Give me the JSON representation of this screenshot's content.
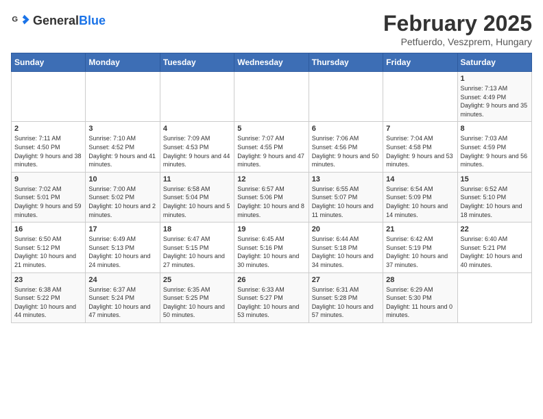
{
  "logo": {
    "text_general": "General",
    "text_blue": "Blue"
  },
  "header": {
    "title": "February 2025",
    "subtitle": "Petfuerdo, Veszprem, Hungary"
  },
  "calendar": {
    "weekdays": [
      "Sunday",
      "Monday",
      "Tuesday",
      "Wednesday",
      "Thursday",
      "Friday",
      "Saturday"
    ],
    "weeks": [
      {
        "days": [
          {
            "num": "",
            "info": ""
          },
          {
            "num": "",
            "info": ""
          },
          {
            "num": "",
            "info": ""
          },
          {
            "num": "",
            "info": ""
          },
          {
            "num": "",
            "info": ""
          },
          {
            "num": "",
            "info": ""
          },
          {
            "num": "1",
            "info": "Sunrise: 7:13 AM\nSunset: 4:49 PM\nDaylight: 9 hours and 35 minutes."
          }
        ]
      },
      {
        "days": [
          {
            "num": "2",
            "info": "Sunrise: 7:11 AM\nSunset: 4:50 PM\nDaylight: 9 hours and 38 minutes."
          },
          {
            "num": "3",
            "info": "Sunrise: 7:10 AM\nSunset: 4:52 PM\nDaylight: 9 hours and 41 minutes."
          },
          {
            "num": "4",
            "info": "Sunrise: 7:09 AM\nSunset: 4:53 PM\nDaylight: 9 hours and 44 minutes."
          },
          {
            "num": "5",
            "info": "Sunrise: 7:07 AM\nSunset: 4:55 PM\nDaylight: 9 hours and 47 minutes."
          },
          {
            "num": "6",
            "info": "Sunrise: 7:06 AM\nSunset: 4:56 PM\nDaylight: 9 hours and 50 minutes."
          },
          {
            "num": "7",
            "info": "Sunrise: 7:04 AM\nSunset: 4:58 PM\nDaylight: 9 hours and 53 minutes."
          },
          {
            "num": "8",
            "info": "Sunrise: 7:03 AM\nSunset: 4:59 PM\nDaylight: 9 hours and 56 minutes."
          }
        ]
      },
      {
        "days": [
          {
            "num": "9",
            "info": "Sunrise: 7:02 AM\nSunset: 5:01 PM\nDaylight: 9 hours and 59 minutes."
          },
          {
            "num": "10",
            "info": "Sunrise: 7:00 AM\nSunset: 5:02 PM\nDaylight: 10 hours and 2 minutes."
          },
          {
            "num": "11",
            "info": "Sunrise: 6:58 AM\nSunset: 5:04 PM\nDaylight: 10 hours and 5 minutes."
          },
          {
            "num": "12",
            "info": "Sunrise: 6:57 AM\nSunset: 5:06 PM\nDaylight: 10 hours and 8 minutes."
          },
          {
            "num": "13",
            "info": "Sunrise: 6:55 AM\nSunset: 5:07 PM\nDaylight: 10 hours and 11 minutes."
          },
          {
            "num": "14",
            "info": "Sunrise: 6:54 AM\nSunset: 5:09 PM\nDaylight: 10 hours and 14 minutes."
          },
          {
            "num": "15",
            "info": "Sunrise: 6:52 AM\nSunset: 5:10 PM\nDaylight: 10 hours and 18 minutes."
          }
        ]
      },
      {
        "days": [
          {
            "num": "16",
            "info": "Sunrise: 6:50 AM\nSunset: 5:12 PM\nDaylight: 10 hours and 21 minutes."
          },
          {
            "num": "17",
            "info": "Sunrise: 6:49 AM\nSunset: 5:13 PM\nDaylight: 10 hours and 24 minutes."
          },
          {
            "num": "18",
            "info": "Sunrise: 6:47 AM\nSunset: 5:15 PM\nDaylight: 10 hours and 27 minutes."
          },
          {
            "num": "19",
            "info": "Sunrise: 6:45 AM\nSunset: 5:16 PM\nDaylight: 10 hours and 30 minutes."
          },
          {
            "num": "20",
            "info": "Sunrise: 6:44 AM\nSunset: 5:18 PM\nDaylight: 10 hours and 34 minutes."
          },
          {
            "num": "21",
            "info": "Sunrise: 6:42 AM\nSunset: 5:19 PM\nDaylight: 10 hours and 37 minutes."
          },
          {
            "num": "22",
            "info": "Sunrise: 6:40 AM\nSunset: 5:21 PM\nDaylight: 10 hours and 40 minutes."
          }
        ]
      },
      {
        "days": [
          {
            "num": "23",
            "info": "Sunrise: 6:38 AM\nSunset: 5:22 PM\nDaylight: 10 hours and 44 minutes."
          },
          {
            "num": "24",
            "info": "Sunrise: 6:37 AM\nSunset: 5:24 PM\nDaylight: 10 hours and 47 minutes."
          },
          {
            "num": "25",
            "info": "Sunrise: 6:35 AM\nSunset: 5:25 PM\nDaylight: 10 hours and 50 minutes."
          },
          {
            "num": "26",
            "info": "Sunrise: 6:33 AM\nSunset: 5:27 PM\nDaylight: 10 hours and 53 minutes."
          },
          {
            "num": "27",
            "info": "Sunrise: 6:31 AM\nSunset: 5:28 PM\nDaylight: 10 hours and 57 minutes."
          },
          {
            "num": "28",
            "info": "Sunrise: 6:29 AM\nSunset: 5:30 PM\nDaylight: 11 hours and 0 minutes."
          },
          {
            "num": "",
            "info": ""
          }
        ]
      }
    ]
  }
}
